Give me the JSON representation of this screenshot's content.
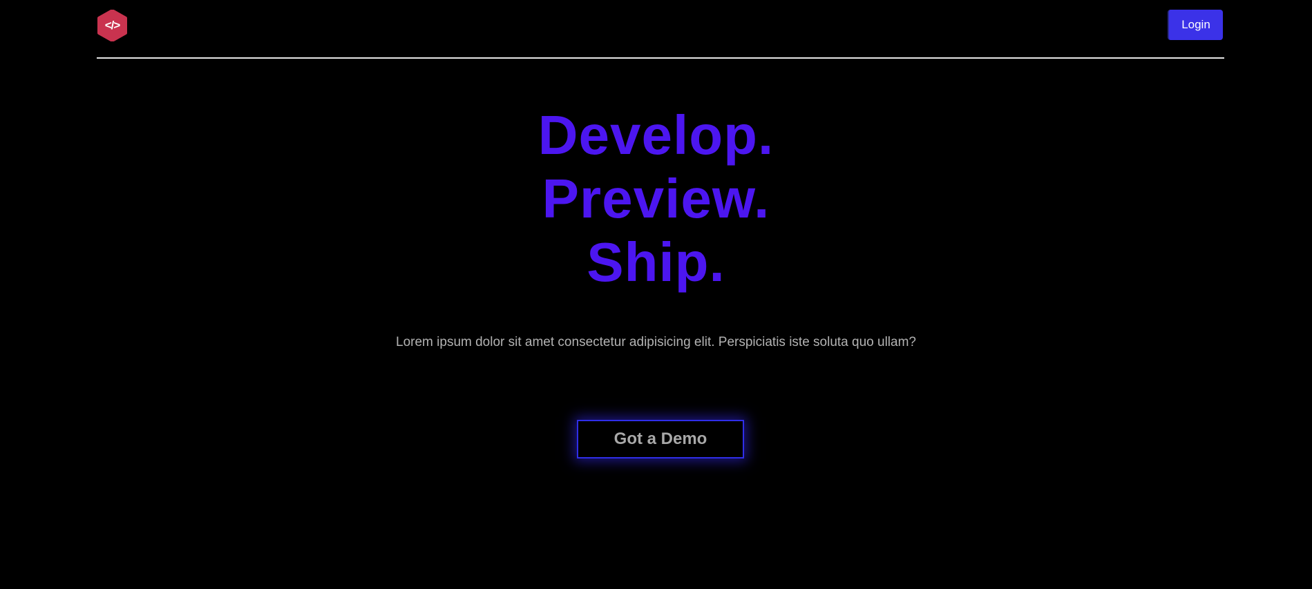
{
  "colors": {
    "background": "#000000",
    "accent_text": "#4c16f0",
    "login_button": "#3b32e8",
    "logo_hexagon": "#c9334f",
    "demo_border": "#2f2ee8",
    "divider": "#e6e6e6"
  },
  "header": {
    "logo_icon": "code-hexagon-icon",
    "logo_glyph": "</>",
    "login_label": "Login"
  },
  "hero": {
    "lines": [
      "Develop.",
      "Preview.",
      "Ship."
    ],
    "subtitle": "Lorem ipsum dolor sit amet consectetur adipisicing elit. Perspiciatis iste soluta quo ullam?",
    "cta_label": "Got a Demo"
  }
}
